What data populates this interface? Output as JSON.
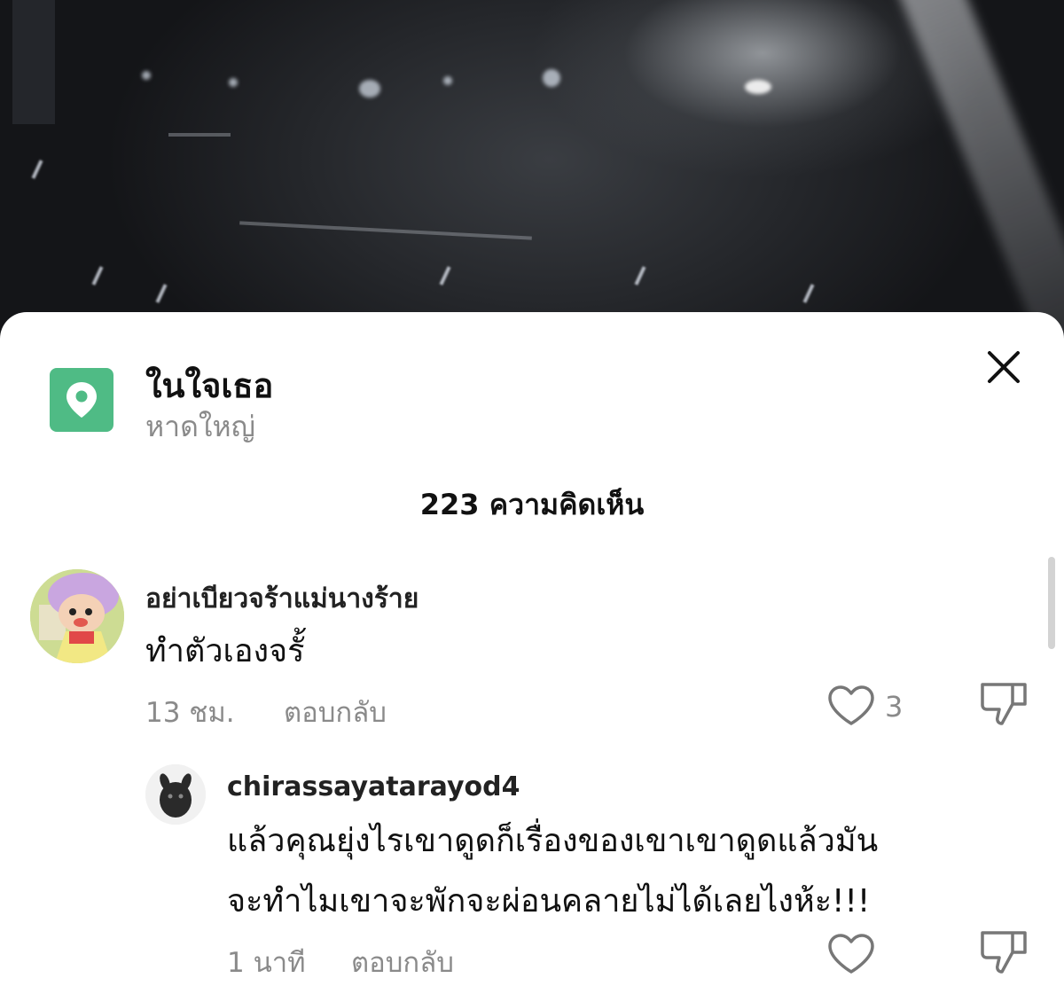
{
  "location": {
    "title": "ในใจเธอ",
    "subtitle": "หาดใหญ่",
    "badge_color": "#4fbb85",
    "icon": "map-pin-icon"
  },
  "comments_header": {
    "count": "223",
    "label": "ความคิดเห็น"
  },
  "comments": [
    {
      "username": "อย่าเบียวจร้าแม่นางร้าย",
      "text": "ทำตัวเองจรั้",
      "time": "13 ชม.",
      "reply_label": "ตอบกลับ",
      "like_count": "3"
    }
  ],
  "replies": [
    {
      "username": "chirassayatarayod4",
      "text_line1": "แล้วคุณยุ่งไรเขาดูดก็เรื่องของเขาเขาดูดแล้วมัน",
      "text_line2": "จะทำไมเขาจะพักจะผ่อนคลายไม่ได้เลยไงห้ะ!!!",
      "time": "1 นาที",
      "reply_label": "ตอบกลับ",
      "like_count": ""
    }
  ],
  "icons": {
    "close": "close-icon",
    "like": "heart-icon",
    "dislike": "thumbs-down-icon"
  }
}
